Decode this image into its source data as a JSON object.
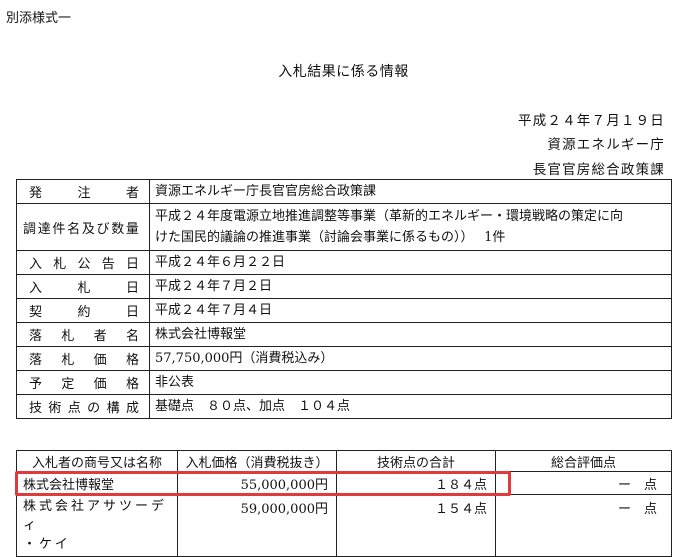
{
  "header": {
    "form_label": "別添様式一",
    "title": "入札結果に係る情報",
    "date": "平成２４年７月１９日",
    "agency": "資源エネルギー庁",
    "department": "長官官房総合政策課"
  },
  "info_rows": [
    {
      "label_chars": [
        "発",
        "注",
        "者"
      ],
      "value_lines": [
        "資源エネルギー庁長官官房総合政策課"
      ]
    },
    {
      "label_chars": [
        "調",
        "達",
        "件",
        "名",
        "及",
        "び",
        "数",
        "量"
      ],
      "value_lines": [
        "平成２４年度電源立地推進調整等事業（革新的エネルギー・環境戦略の策定に向",
        "けた国民的議論の推進事業（討論会事業に係るもの））　 1件"
      ]
    },
    {
      "label_chars": [
        "入",
        "札",
        "公",
        "告",
        "日"
      ],
      "value_lines": [
        "平成２４年６月２２日"
      ]
    },
    {
      "label_chars": [
        "入",
        "札",
        "日"
      ],
      "value_lines": [
        "平成２４年７月２日"
      ]
    },
    {
      "label_chars": [
        "契",
        "約",
        "日"
      ],
      "value_lines": [
        "平成２４年７月４日"
      ]
    },
    {
      "label_chars": [
        "落",
        "札",
        "者",
        "名"
      ],
      "value_lines": [
        "株式会社博報堂"
      ]
    },
    {
      "label_chars": [
        "落",
        "札",
        "価",
        "格"
      ],
      "value_lines": [
        "57,750,000円（消費税込み）"
      ]
    },
    {
      "label_chars": [
        "予",
        "定",
        "価",
        "格"
      ],
      "value_lines": [
        "非公表"
      ]
    },
    {
      "label_chars": [
        "技",
        "術",
        "点",
        "の",
        "構",
        "成"
      ],
      "value_lines": [
        "基礎点　８０点、加点　１０４点"
      ]
    }
  ],
  "results": {
    "headers": [
      "入札者の商号又は名称",
      "入札価格（消費税抜き）",
      "技術点の合計",
      "総合評価点"
    ],
    "rows": [
      {
        "name_lines": [
          "株式会社博報堂"
        ],
        "price": "55,000,000円",
        "tech_score": "１８４点",
        "total_score": "ー　点"
      },
      {
        "name_lines": [
          "株式会社アサツーディ",
          "・ケイ"
        ],
        "price": "59,000,000円",
        "tech_score": "１５４点",
        "total_score": "ー　点"
      }
    ]
  },
  "highlight_color": "#e03a3a"
}
